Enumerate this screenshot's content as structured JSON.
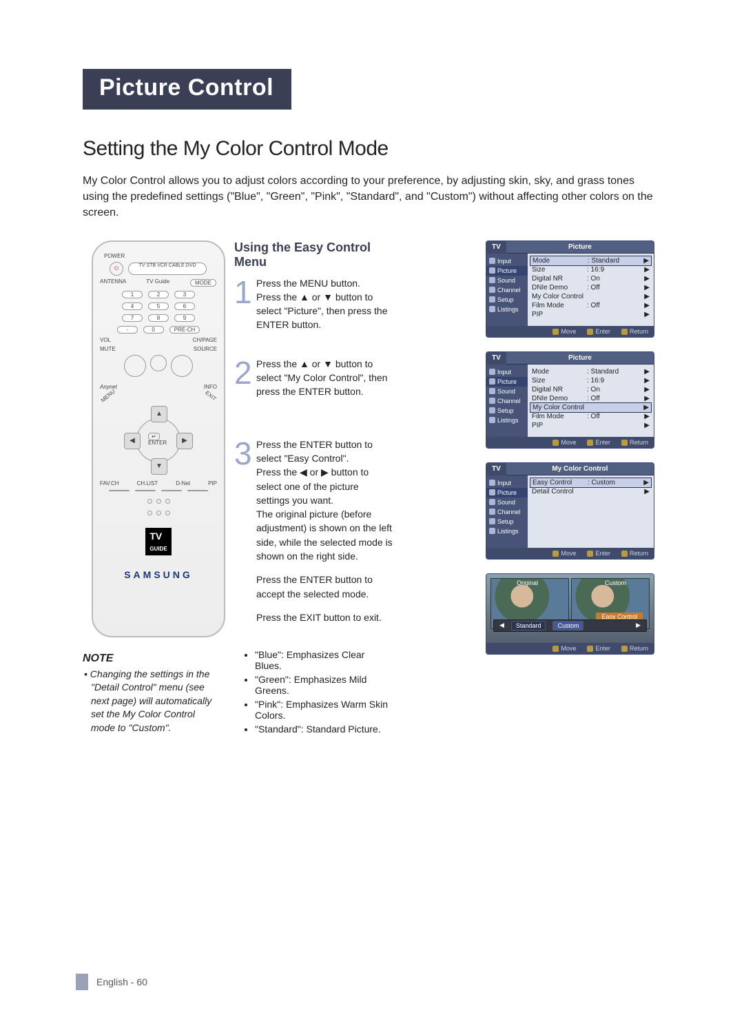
{
  "chapter": "Picture Control",
  "section_title": "Setting the My Color Control Mode",
  "intro": "My Color Control allows you to adjust colors according to your preference, by adjusting skin, sky, and grass tones using the predefined settings (\"Blue\", \"Green\", \"Pink\", \"Standard\", and \"Custom\") without affecting other colors on the screen.",
  "subheading": "Using the Easy Control Menu",
  "remote": {
    "power_label": "POWER",
    "device_row": "TV  STB  VCR  CABLE  DVD",
    "antenna": "ANTENNA",
    "tvguide_btn": "TV Guide",
    "mode_btn": "MODE",
    "digits": [
      "1",
      "2",
      "3",
      "4",
      "5",
      "6",
      "7",
      "8",
      "9",
      "-",
      "0",
      "PRE-CH"
    ],
    "vol": "VOL",
    "chpage": "CH/PAGE",
    "mute": "MUTE",
    "source": "SOURCE",
    "anynet": "Anynet",
    "info": "INFO",
    "menu": "MENU",
    "exit": "EXIT",
    "enter": "ENTER",
    "favch": "FAV.CH",
    "chlist": "CH.LIST",
    "dnet": "D-Net",
    "pip": "PIP",
    "guide_badge_top": "TV",
    "guide_badge_bot": "GUIDE",
    "brand": "SAMSUNG"
  },
  "steps": {
    "s1": "Press the MENU button.\nPress the ▲ or ▼ button to select \"Picture\", then press the ENTER button.",
    "s2": "Press the ▲ or ▼ button to select \"My Color Control\", then press the ENTER button.",
    "s3a": "Press the ENTER button to select \"Easy Control\".\nPress the ◀ or ▶ button to select one of the picture settings you want.\nThe original picture (before adjustment) is shown on the left side, while the selected mode is shown on the right side.",
    "s3b": "Press the ENTER button to accept the selected mode.",
    "s3c": "Press the EXIT button to exit."
  },
  "colors": {
    "c1": "\"Blue\": Emphasizes Clear Blues.",
    "c2": "\"Green\": Emphasizes Mild Greens.",
    "c3": "\"Pink\": Emphasizes Warm Skin Colors.",
    "c4": "\"Standard\": Standard Picture."
  },
  "note": {
    "heading": "NOTE",
    "body": "• Changing the settings in the \"Detail Control\" menu (see next page) will automatically set the My Color Control mode to \"Custom\"."
  },
  "osd_common": {
    "tv_tab": "TV",
    "sidebar": [
      "Input",
      "Picture",
      "Sound",
      "Channel",
      "Setup",
      "Listings"
    ],
    "footer_move": "Move",
    "footer_enter": "Enter",
    "footer_return": "Return"
  },
  "osd1": {
    "title": "Picture",
    "rows": [
      {
        "k": "Mode",
        "v": ": Standard"
      },
      {
        "k": "Size",
        "v": ": 16:9"
      },
      {
        "k": "Digital NR",
        "v": ": On"
      },
      {
        "k": "DNIe Demo",
        "v": ": Off"
      },
      {
        "k": "My Color Control",
        "v": ""
      },
      {
        "k": "Film Mode",
        "v": ": Off"
      },
      {
        "k": "PIP",
        "v": ""
      }
    ],
    "hl_index": 0
  },
  "osd2": {
    "title": "Picture",
    "rows": [
      {
        "k": "Mode",
        "v": ": Standard"
      },
      {
        "k": "Size",
        "v": ": 16:9"
      },
      {
        "k": "Digital NR",
        "v": ": On"
      },
      {
        "k": "DNIe Demo",
        "v": ": Off"
      },
      {
        "k": "My Color Control",
        "v": ""
      },
      {
        "k": "Film Mode",
        "v": ": Off"
      },
      {
        "k": "PIP",
        "v": ""
      }
    ],
    "hl_index": 4
  },
  "osd3": {
    "title": "My Color Control",
    "rows": [
      {
        "k": "Easy Control",
        "v": ": Custom"
      },
      {
        "k": "Detail Control",
        "v": ""
      }
    ],
    "hl_index": 0
  },
  "preview": {
    "orig": "Original",
    "cust": "Custom",
    "tag": "Easy Control",
    "chips_left": "◀",
    "opt1": "Standard",
    "opt2": "Custom",
    "chips_right": "▶",
    "f_move": "Move",
    "f_enter": "Enter",
    "f_return": "Return"
  },
  "footer": "English - 60"
}
